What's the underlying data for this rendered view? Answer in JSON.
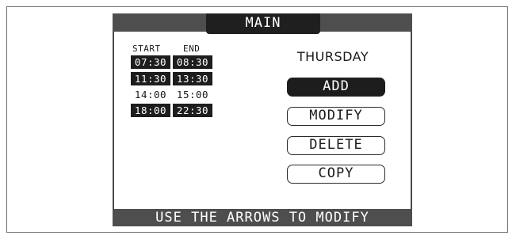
{
  "screen": {
    "title": "MAIN",
    "day": "THURSDAY",
    "footer_hint": "USE THE ARROWS TO MODIFY"
  },
  "schedule": {
    "start_header": "START",
    "end_header": "END",
    "rows": [
      {
        "start": "07:30",
        "end": "08:30",
        "highlighted": true
      },
      {
        "start": "11:30",
        "end": "13:30",
        "highlighted": true
      },
      {
        "start": "14:00",
        "end": "15:00",
        "highlighted": false
      },
      {
        "start": "18:00",
        "end": "22:30",
        "highlighted": true
      }
    ]
  },
  "menu": {
    "add_label": "ADD",
    "modify_label": "MODIFY",
    "delete_label": "DELETE",
    "copy_label": "COPY",
    "selected": "ADD"
  },
  "colors": {
    "bar": "#4e4e4e",
    "highlight": "#1d1d1d",
    "text_on_dark": "#ffffff"
  }
}
